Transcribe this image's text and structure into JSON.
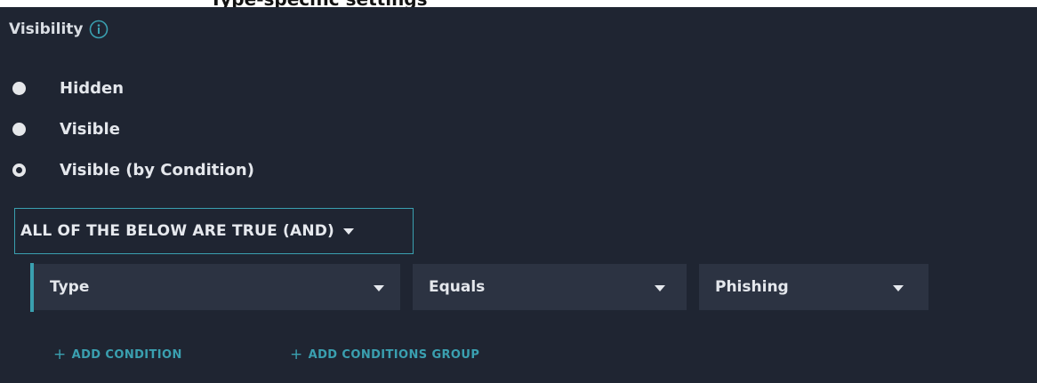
{
  "header_strip": {
    "text": "Type-specific settings"
  },
  "visibility": {
    "heading": "Visibility",
    "info_icon": "info-circle-icon",
    "accent_color": "#3aa0b0",
    "options": [
      {
        "label": "Hidden",
        "selected": false
      },
      {
        "label": "Visible",
        "selected": false
      },
      {
        "label": "Visible (by Condition)",
        "selected": true
      }
    ]
  },
  "condition_logic": {
    "selected_label": "ALL OF THE BELOW ARE TRUE (AND)"
  },
  "condition": {
    "field": "Type",
    "operator": "Equals",
    "value": "Phishing"
  },
  "actions": {
    "add_condition": "ADD CONDITION",
    "add_conditions_group": "ADD CONDITIONS GROUP",
    "plus_icon": "plus-icon"
  }
}
